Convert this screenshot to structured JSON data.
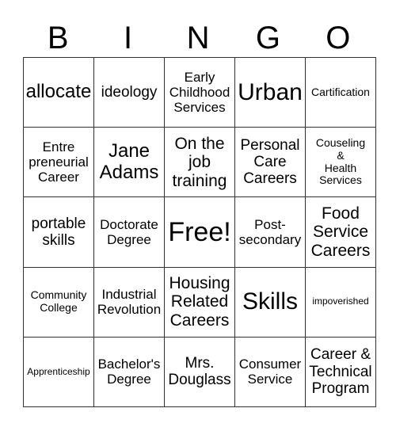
{
  "header": {
    "letters": [
      "B",
      "I",
      "N",
      "G",
      "O"
    ]
  },
  "grid": {
    "rows": [
      [
        "allocate",
        "ideology",
        "Early\nChildhood\nServices",
        "Urban",
        "Cartification"
      ],
      [
        "Entre\npreneurial\nCareer",
        "Jane\nAdams",
        "On the\njob\ntraining",
        "Personal\nCare\nCareers",
        "Couseling\n&\nHealth\nServices"
      ],
      [
        "portable\nskills",
        "Doctorate\nDegree",
        "Free!",
        "Post-\nsecondary",
        "Food\nService\nCareers"
      ],
      [
        "Community\nCollege",
        "Industrial\nRevolution",
        "Housing\nRelated\nCareers",
        "Skills",
        "impoverished"
      ],
      [
        "Apprenticeship",
        "Bachelor's\nDegree",
        "Mrs.\nDouglass",
        "Consumer\nService",
        "Career &\nTechnical\nProgram"
      ]
    ]
  }
}
